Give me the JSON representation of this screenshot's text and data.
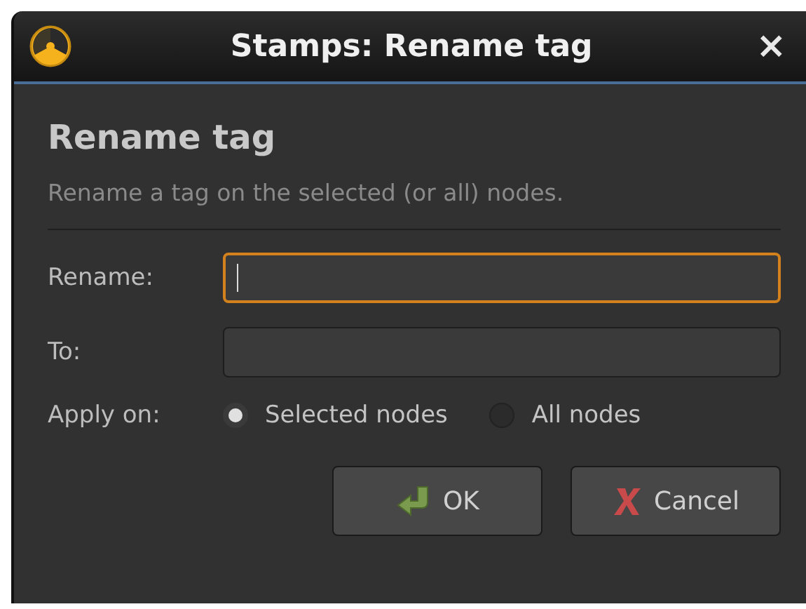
{
  "window": {
    "title": "Stamps: Rename tag",
    "close": "×"
  },
  "heading": "Rename tag",
  "description": "Rename a tag on the selected (or all) nodes.",
  "fields": [
    {
      "label": "Rename:",
      "focused": true
    },
    {
      "label": "To:",
      "focused": false
    }
  ],
  "apply_on": {
    "label": "Apply on:",
    "options": [
      {
        "label": "Selected nodes",
        "selected": true
      },
      {
        "label": "All nodes",
        "selected": false
      }
    ]
  },
  "buttons": [
    {
      "kind": "ok",
      "label": "OK"
    },
    {
      "kind": "cancel",
      "label": "Cancel"
    }
  ]
}
